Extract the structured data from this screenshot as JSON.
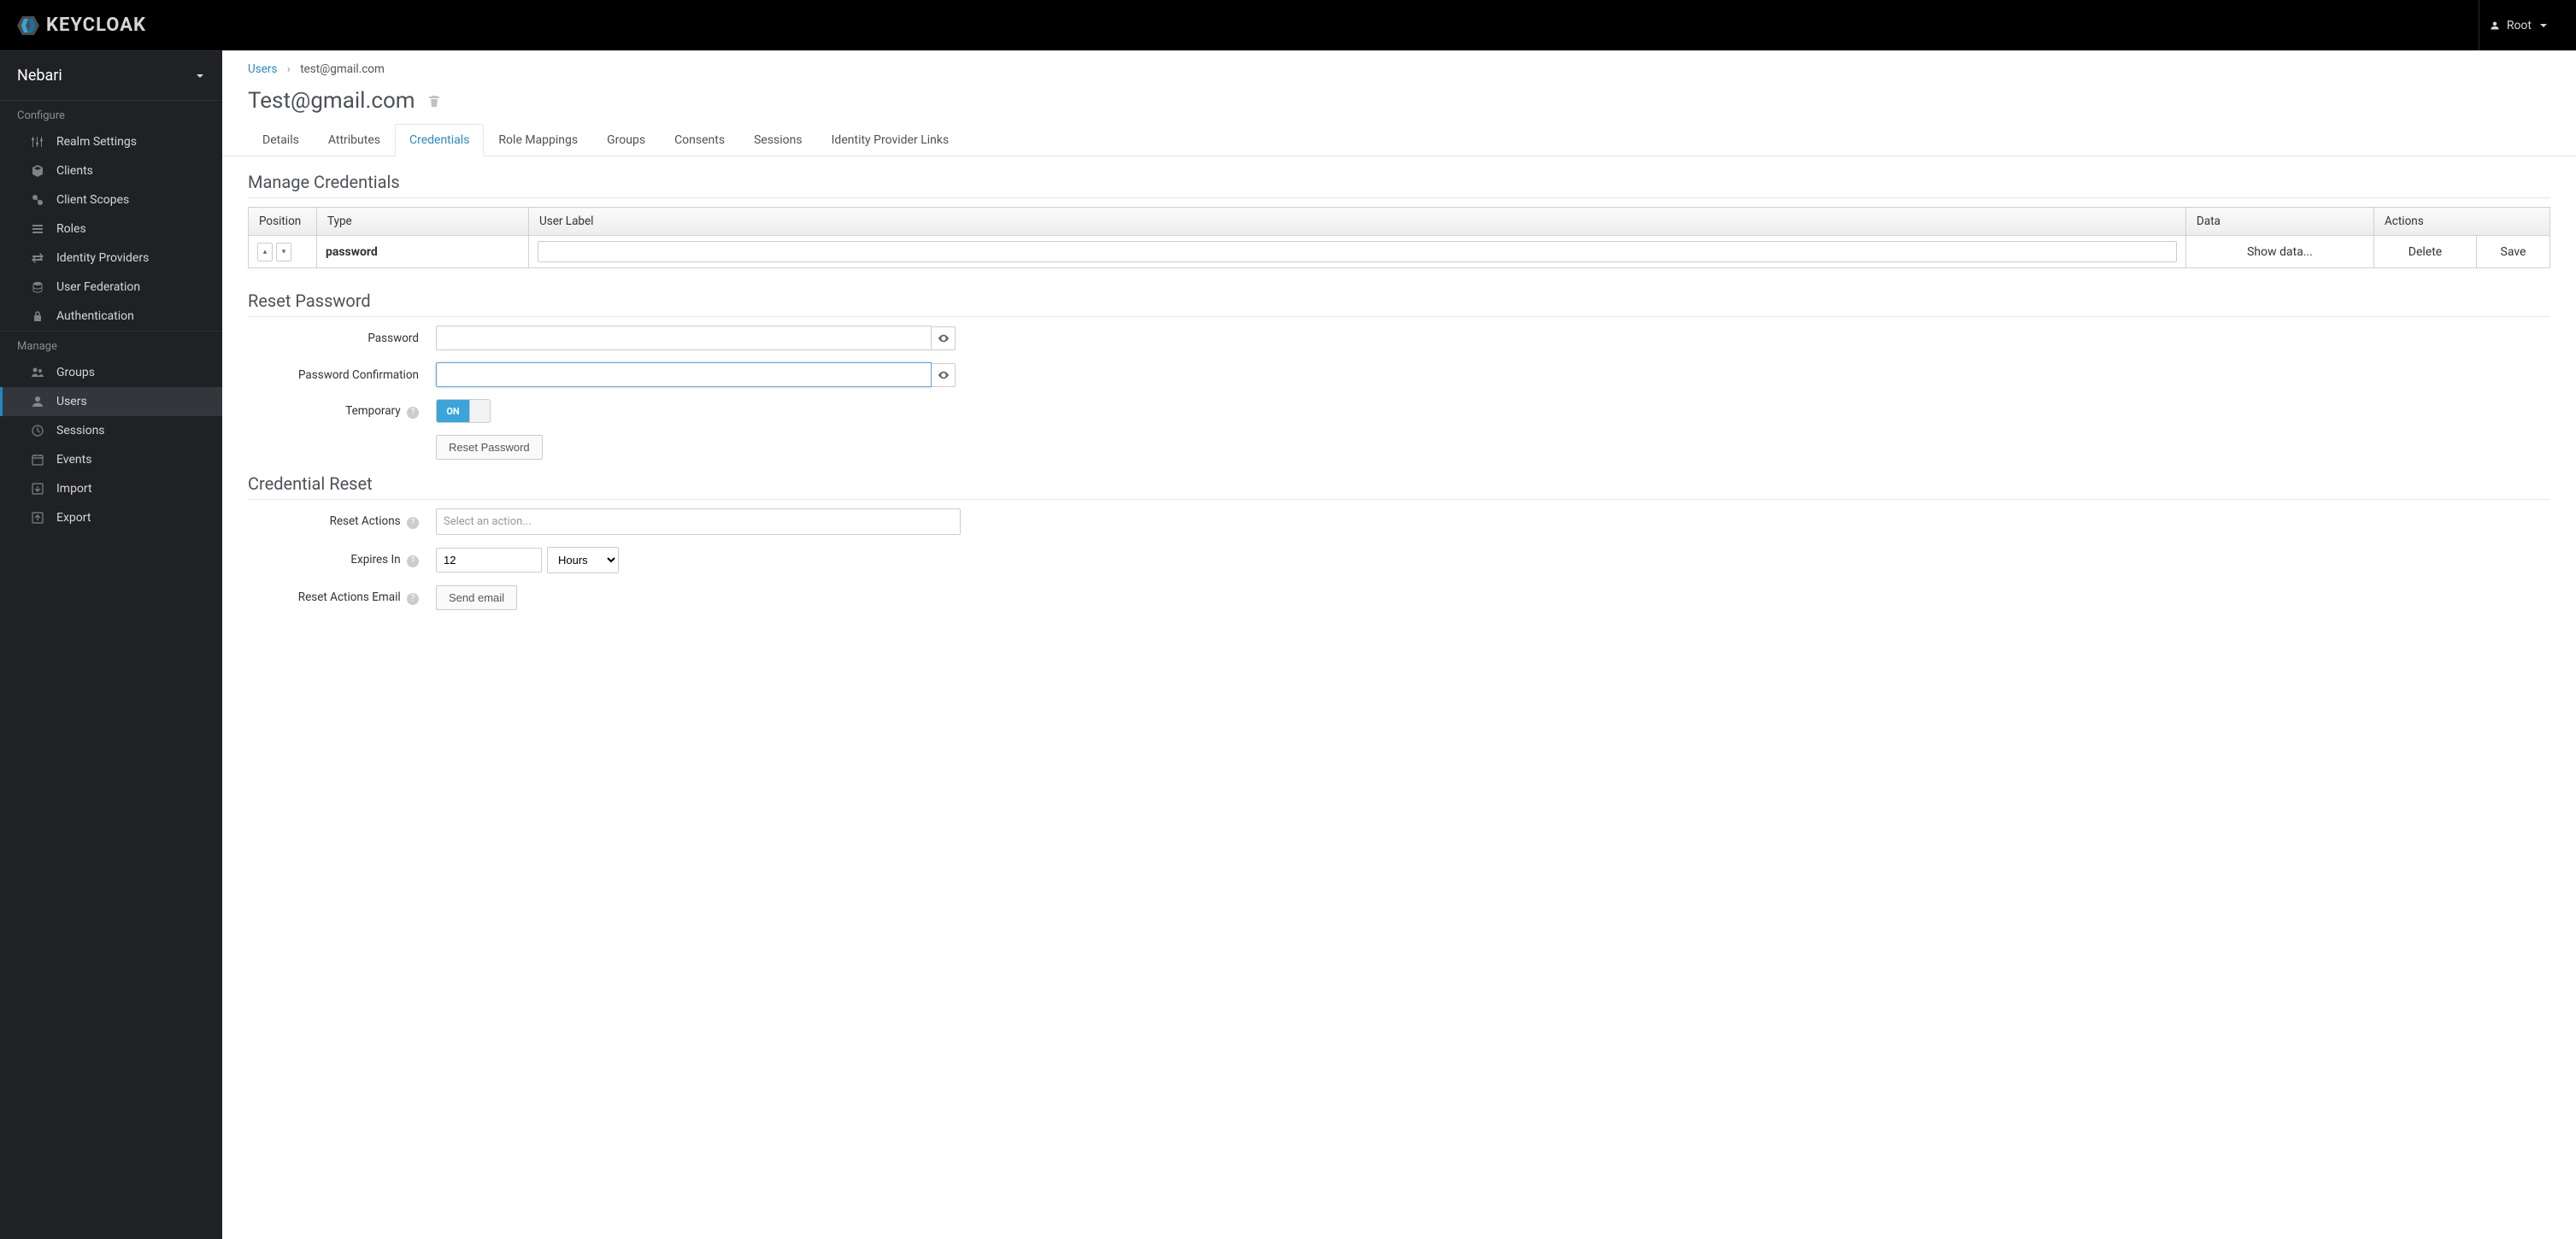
{
  "topbar": {
    "brand": "KEYCLOAK",
    "user": "Root"
  },
  "sidebar": {
    "realm": "Nebari",
    "configure_header": "Configure",
    "manage_header": "Manage",
    "configure": [
      {
        "label": "Realm Settings"
      },
      {
        "label": "Clients"
      },
      {
        "label": "Client Scopes"
      },
      {
        "label": "Roles"
      },
      {
        "label": "Identity Providers"
      },
      {
        "label": "User Federation"
      },
      {
        "label": "Authentication"
      }
    ],
    "manage": [
      {
        "label": "Groups"
      },
      {
        "label": "Users"
      },
      {
        "label": "Sessions"
      },
      {
        "label": "Events"
      },
      {
        "label": "Import"
      },
      {
        "label": "Export"
      }
    ]
  },
  "breadcrumb": {
    "parent": "Users",
    "current": "test@gmail.com"
  },
  "page_title": "Test@gmail.com",
  "tabs": [
    {
      "label": "Details"
    },
    {
      "label": "Attributes"
    },
    {
      "label": "Credentials"
    },
    {
      "label": "Role Mappings"
    },
    {
      "label": "Groups"
    },
    {
      "label": "Consents"
    },
    {
      "label": "Sessions"
    },
    {
      "label": "Identity Provider Links"
    }
  ],
  "manage_creds": {
    "heading": "Manage Credentials",
    "cols": {
      "position": "Position",
      "type": "Type",
      "user_label": "User Label",
      "data": "Data",
      "actions": "Actions"
    },
    "row": {
      "type": "password",
      "user_label": "",
      "show_data": "Show data...",
      "delete": "Delete",
      "save": "Save"
    }
  },
  "reset_pw": {
    "heading": "Reset Password",
    "password_label": "Password",
    "confirm_label": "Password Confirmation",
    "temporary_label": "Temporary",
    "toggle_on": "ON",
    "button": "Reset Password"
  },
  "cred_reset": {
    "heading": "Credential Reset",
    "reset_actions_label": "Reset Actions",
    "reset_actions_placeholder": "Select an action...",
    "expires_label": "Expires In",
    "expires_value": "12",
    "expires_unit": "Hours",
    "email_label": "Reset Actions Email",
    "email_button": "Send email"
  }
}
